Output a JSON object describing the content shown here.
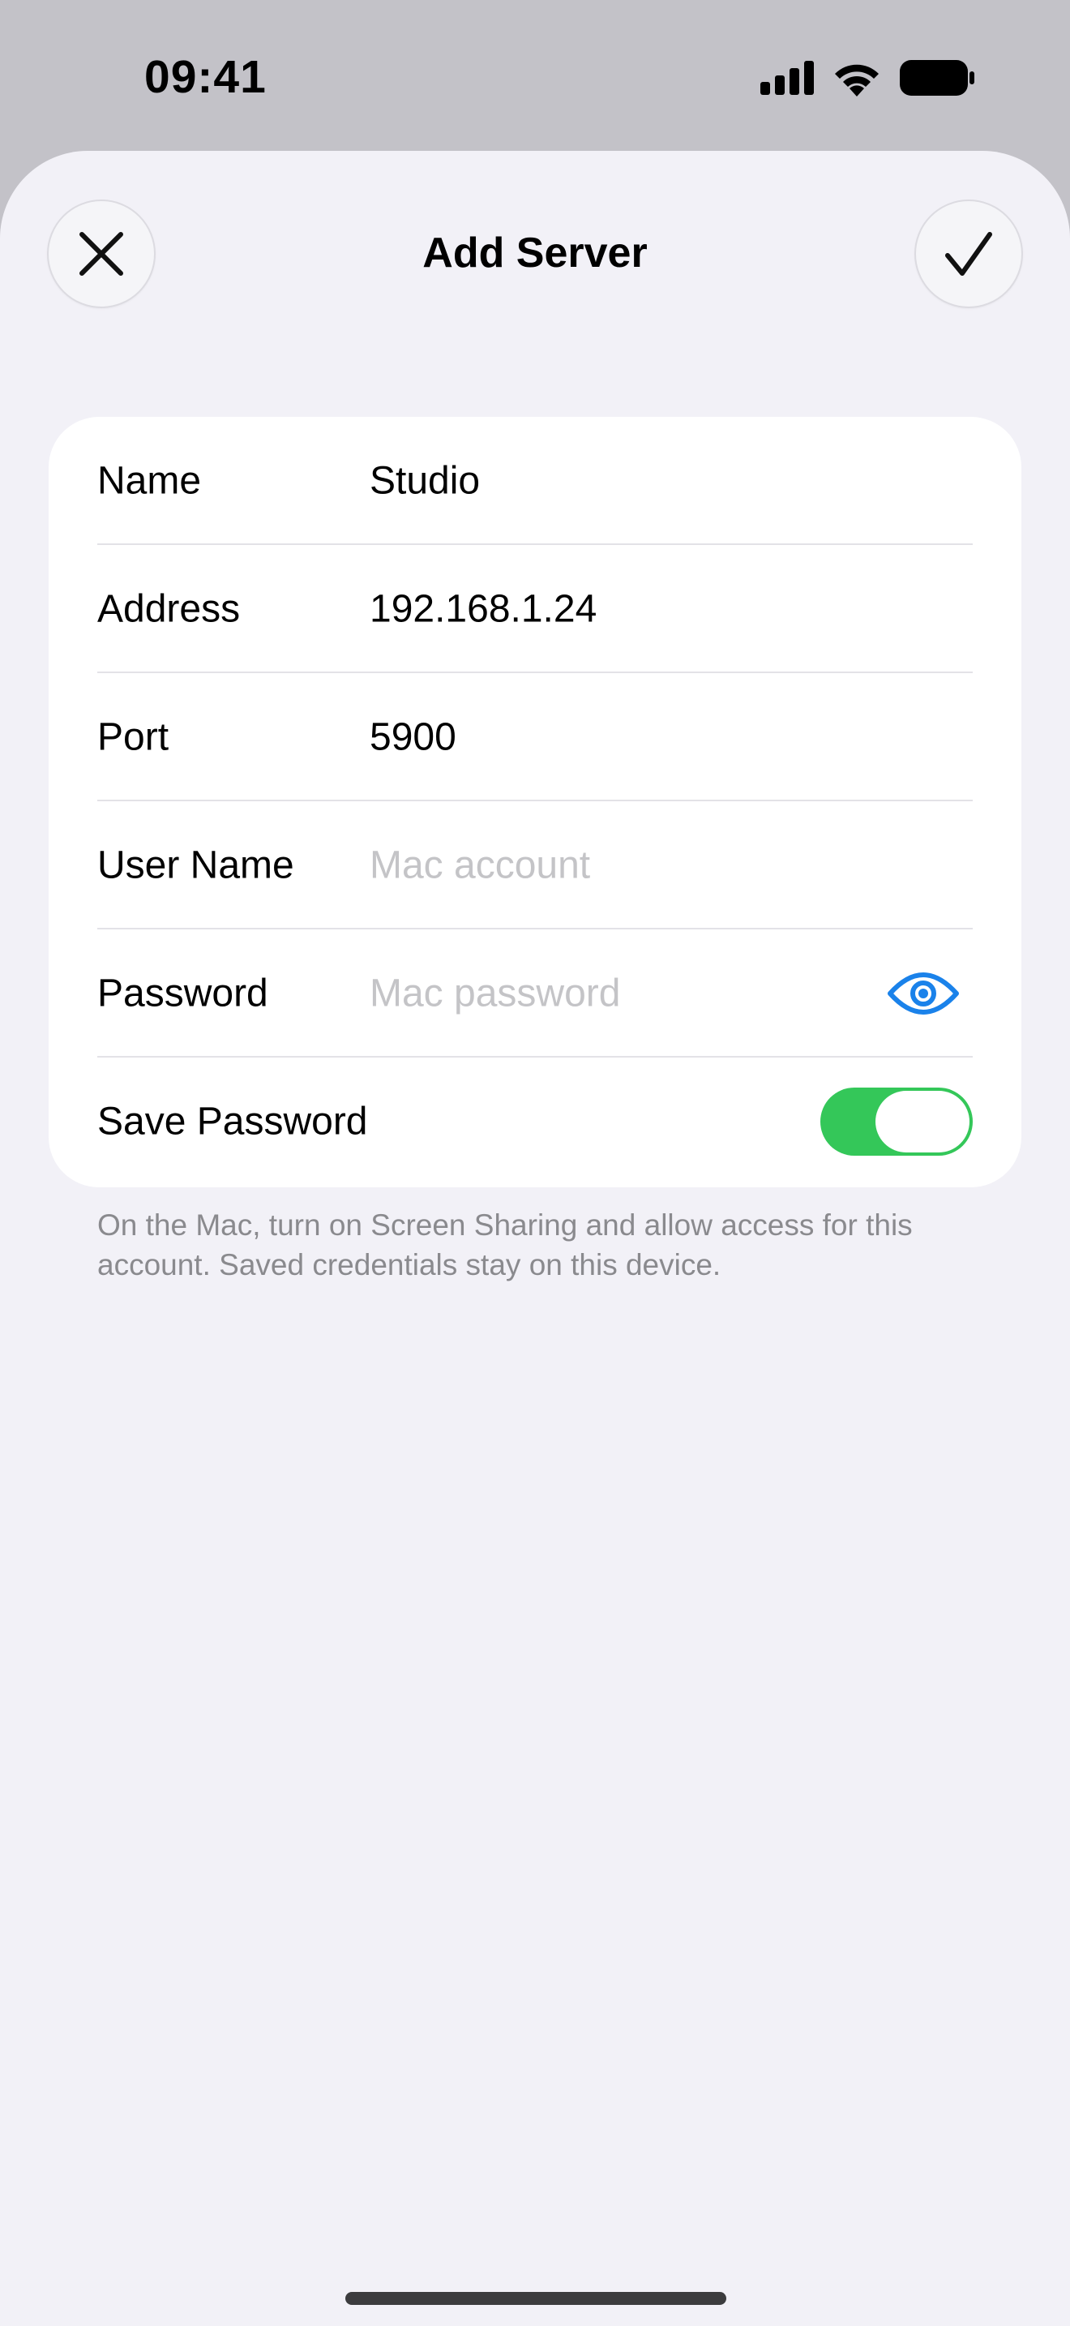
{
  "status_bar": {
    "time": "09:41",
    "icons": [
      "cellular-signal-icon",
      "wifi-icon",
      "battery-icon"
    ]
  },
  "sheet": {
    "title": "Add Server",
    "close_icon": "close-icon",
    "done_icon": "checkmark-icon"
  },
  "form": {
    "rows": [
      {
        "label": "Name",
        "value": "Studio",
        "placeholder": ""
      },
      {
        "label": "Address",
        "value": "192.168.1.24",
        "placeholder": ""
      },
      {
        "label": "Port",
        "value": "5900",
        "placeholder": ""
      },
      {
        "label": "User Name",
        "value": "",
        "placeholder": "Mac account"
      },
      {
        "label": "Password",
        "value": "",
        "placeholder": "Mac password"
      },
      {
        "label": "Save Password",
        "toggle_on": true
      }
    ],
    "footnote": "On the Mac, turn on Screen Sharing and allow access for this account. Saved credentials stay on this device."
  },
  "colors": {
    "accent": "#1a82ea",
    "toggle_on": "#34c759",
    "sheet_bg": "#f2f1f7",
    "placeholder": "#c4c4c7"
  }
}
